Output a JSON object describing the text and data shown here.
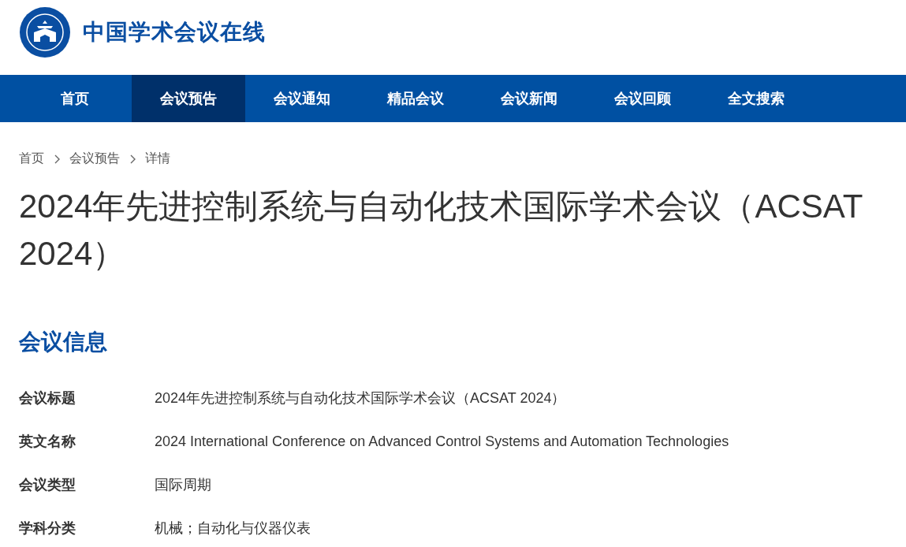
{
  "site": {
    "name": "中国学术会议在线"
  },
  "nav": [
    {
      "label": "首页",
      "selected": false
    },
    {
      "label": "会议预告",
      "selected": true
    },
    {
      "label": "会议通知",
      "selected": false
    },
    {
      "label": "精品会议",
      "selected": false
    },
    {
      "label": "会议新闻",
      "selected": false
    },
    {
      "label": "会议回顾",
      "selected": false
    },
    {
      "label": "全文搜索",
      "selected": false
    }
  ],
  "breadcrumb": [
    "首页",
    "会议预告",
    "详情"
  ],
  "title": "2024年先进控制系统与自动化技术国际学术会议（ACSAT 2024）",
  "section": {
    "heading": "会议信息",
    "fields": [
      {
        "label": "会议标题",
        "value": "2024年先进控制系统与自动化技术国际学术会议（ACSAT 2024）"
      },
      {
        "label": "英文名称",
        "value": "2024 International Conference on Advanced Control Systems and Automation Technologies"
      },
      {
        "label": "会议类型",
        "value": "国际周期"
      },
      {
        "label": "学科分类",
        "value": "机械；自动化与仪器仪表"
      }
    ]
  }
}
